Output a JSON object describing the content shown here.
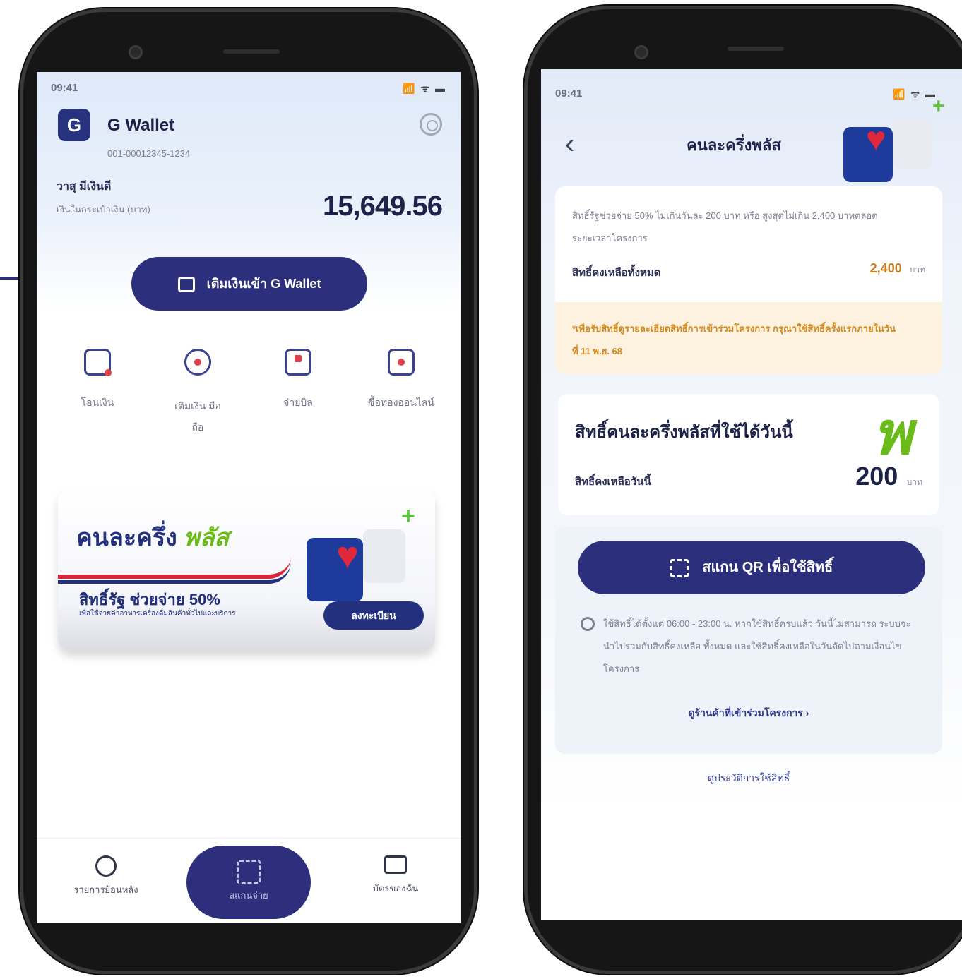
{
  "left_phone": {
    "status_time": "09:41",
    "status_icons": "📶 ᯤ ▬",
    "app_logo_letter": "G",
    "app_title": "G Wallet",
    "account_number": "001-00012345-1234",
    "user_name": "วาสุ มีเงินดี",
    "balance_label": "เงินในกระเป๋าเงิน (บาท)",
    "balance": "15,649.56",
    "topup_button": "เติมเงินเข้า G Wallet",
    "menu": [
      {
        "icon": "qr-card-icon",
        "label": "โอนเงิน"
      },
      {
        "icon": "add-circle-icon",
        "label": "เติมเงิน มือถือ"
      },
      {
        "icon": "bill-icon",
        "label": "จ่ายบิล"
      },
      {
        "icon": "shopping-bag-icon",
        "label": "ซื้อทองออนไลน์"
      }
    ],
    "banner": {
      "title": "คนละครึ่ง",
      "title_plus": "พลัส",
      "subtitle": "สิทธิ์รัฐ ช่วยจ่าย 50%",
      "small_text": "เพื่อใช้จ่ายค่าอาหารเครื่องดื่มสินค้าทั่วไปและบริการ",
      "cta": "ลงทะเบียน"
    },
    "bottom_nav": {
      "history_label": "รายการย้อนหลัง",
      "scan_label": "สแกนจ่าย",
      "wallet_label": "บัตรของฉัน"
    }
  },
  "right_phone": {
    "status_time": "09:41",
    "status_icons": "📶 ᯤ ▬",
    "title": "คนละครึ่งพลัส",
    "info_text": "สิทธิ์รัฐช่วยจ่าย 50% ไม่เกินวันละ 200 บาท หรือ สูงสุดไม่เกิน 2,400 บาทตลอดระยะเวลาโครงการ",
    "total_rights_label": "สิทธิ์คงเหลือทั้งหมด",
    "total_rights_value": "2,400",
    "currency": "บาท",
    "warning_text": "*เพื่อรับสิทธิ์ดูรายละเอียดสิทธิ์การเข้าร่วมโครงการ กรุณาใช้สิทธิ์ครั้งแรกภายในวันที่ 11 พ.ย. 68",
    "today_header": "สิทธิ์คนละครึ่งพลัสที่ใช้ได้วันนี้",
    "today_label": "สิทธิ์คงเหลือวันนี้",
    "today_value": "200",
    "scan_button": "สแกน QR เพื่อใช้สิทธิ์",
    "note_text": "ใช้สิทธิ์ได้ตั้งแต่ 06:00 - 23:00 น. หากใช้สิทธิ์ครบแล้ว วันนี้ไม่สามารถ ระบบจะนำไปรวมกับสิทธิ์คงเหลือ ทั้งหมด และใช้สิทธิ์คงเหลือในวันถัดไปตามเงื่อนไขโครงการ",
    "shops_link": "ดูร้านค้าที่เข้าร่วมโครงการ ›",
    "history_link": "ดูประวัติการใช้สิทธิ์",
    "brand_logo_text": "พ"
  },
  "colors": {
    "navy": "#2c2f7c",
    "accent_green": "#6aba1a",
    "warning_bg": "#fdf1df",
    "warning_text": "#d28a1d"
  }
}
